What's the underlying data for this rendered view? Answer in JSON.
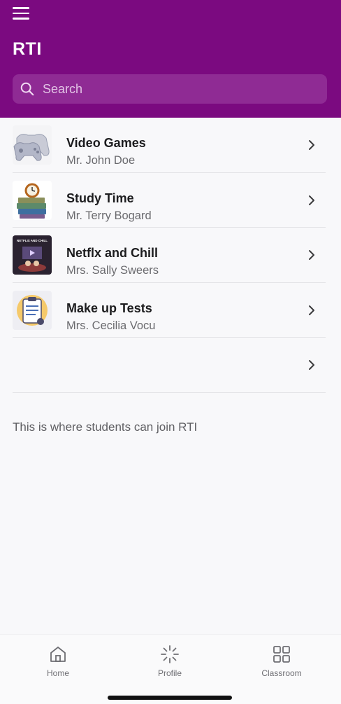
{
  "header": {
    "title": "RTI",
    "search_placeholder": "Search",
    "background_color": "#7b0a80"
  },
  "icons": {
    "menu": "menu-icon",
    "search": "search-icon",
    "chevron": "chevron-right-icon"
  },
  "classes": [
    {
      "title": "Video Games",
      "teacher": "Mr. John Doe",
      "thumbnail": "game-controller-thumbnail"
    },
    {
      "title": "Study Time",
      "teacher": "Mr. Terry Bogard",
      "thumbnail": "books-clock-thumbnail"
    },
    {
      "title": "Netflx and Chill",
      "teacher": "Mrs. Sally Sweers",
      "thumbnail": "netflix-chill-thumbnail",
      "thumbnail_text": "NETFLIX AND CHILL"
    },
    {
      "title": "Make up Tests",
      "teacher": "Mrs. Cecilia Vocu",
      "thumbnail": "clipboard-test-thumbnail"
    },
    {
      "title": "",
      "teacher": ""
    }
  ],
  "info_text": "This is where students can join RTI",
  "tabbar": {
    "tabs": [
      {
        "label": "Home",
        "icon": "home-icon"
      },
      {
        "label": "Profile",
        "icon": "loading-spinner-icon"
      },
      {
        "label": "Classroom",
        "icon": "grid-icon"
      }
    ]
  }
}
